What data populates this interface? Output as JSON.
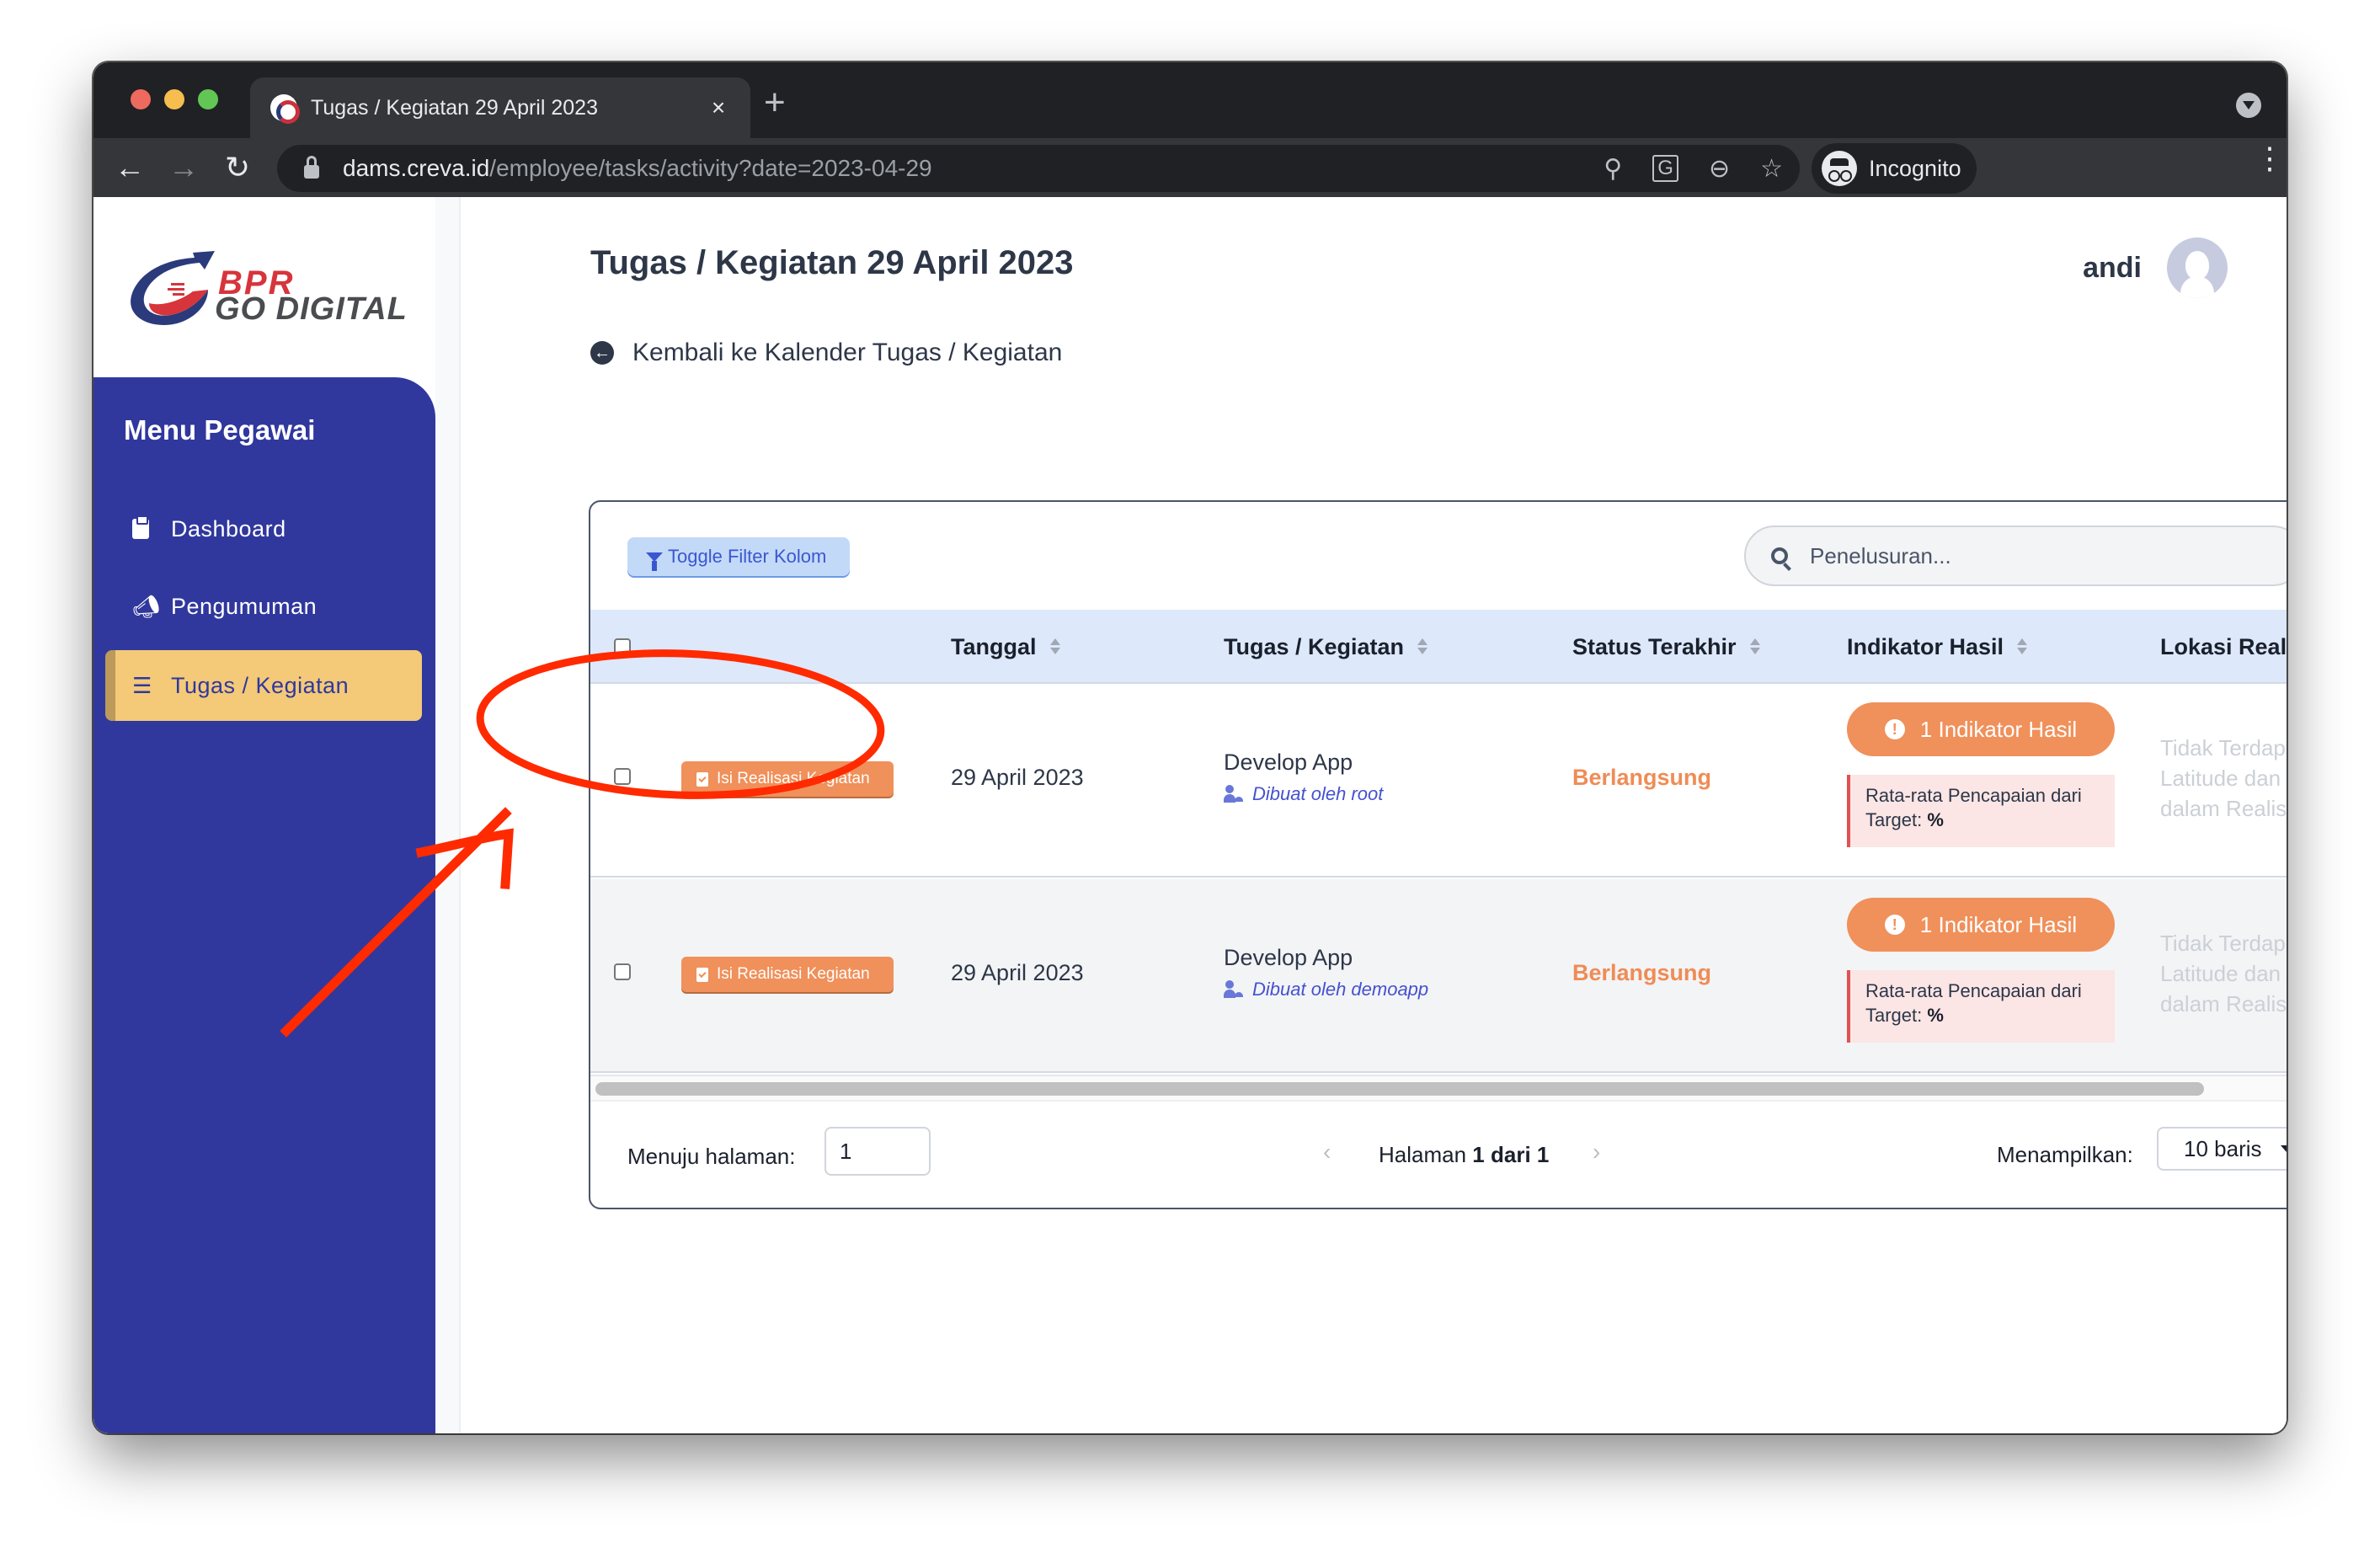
{
  "browser": {
    "tab_title": "Tugas / Kegiatan 29 April 2023",
    "tab_close": "×",
    "new_tab": "+",
    "url_host": "dams.creva.id",
    "url_path": "/employee/tasks/activity?date=2023-04-29",
    "incognito_label": "Incognito",
    "icons": [
      "key-icon",
      "translate-icon",
      "zoom-out-icon",
      "star-icon"
    ]
  },
  "logo": {
    "line1": "BPR",
    "line2": "GO DIGITAL"
  },
  "sidebar": {
    "title": "Menu Pegawai",
    "items": [
      {
        "label": "Dashboard",
        "icon": "clipboard-icon",
        "active": false
      },
      {
        "label": "Pengumuman",
        "icon": "megaphone-icon",
        "active": false
      },
      {
        "label": "Tugas / Kegiatan",
        "icon": "checklist-icon",
        "active": true
      }
    ]
  },
  "header": {
    "title": "Tugas / Kegiatan 29 April 2023",
    "user_name": "andi",
    "back_link": "Kembali ke Kalender Tugas / Kegiatan"
  },
  "table": {
    "filter_button": "Toggle Filter Kolom",
    "search_placeholder": "Penelusuran...",
    "columns": [
      "Tanggal",
      "Tugas / Kegiatan",
      "Status Terakhir",
      "Indikator Hasil",
      "Lokasi Realisasi"
    ],
    "rows": [
      {
        "action": "Isi Realisasi Kegiatan",
        "date": "29 April 2023",
        "task": "Develop App",
        "created_by": "Dibuat oleh root",
        "status": "Berlangsung",
        "indicator_count": "1 Indikator Hasil",
        "indicator_label": "Rata-rata Pencapaian dari Target:",
        "indicator_value": "%",
        "location": [
          "Tidak Terdapat P",
          "Latitude dan Long",
          "dalam Realisasi K"
        ]
      },
      {
        "action": "Isi Realisasi Kegiatan",
        "date": "29 April 2023",
        "task": "Develop App",
        "created_by": "Dibuat oleh demoapp",
        "status": "Berlangsung",
        "indicator_count": "1 Indikator Hasil",
        "indicator_label": "Rata-rata Pencapaian dari Target:",
        "indicator_value": "%",
        "location": [
          "Tidak Terdapat P",
          "Latitude dan Long",
          "dalam Realisasi K"
        ]
      }
    ]
  },
  "pagination": {
    "goto_label": "Menuju halaman:",
    "goto_value": "1",
    "page_prefix": "Halaman",
    "page_current": "1 dari 1",
    "show_label": "Menampilkan:",
    "show_value": "10 baris"
  },
  "colors": {
    "sidebar_bg": "#30389d",
    "active_item_bg": "#f4c978",
    "accent_orange": "#f0905a",
    "header_row_bg": "#dde8fa",
    "annotation_red": "#ff2a00"
  }
}
